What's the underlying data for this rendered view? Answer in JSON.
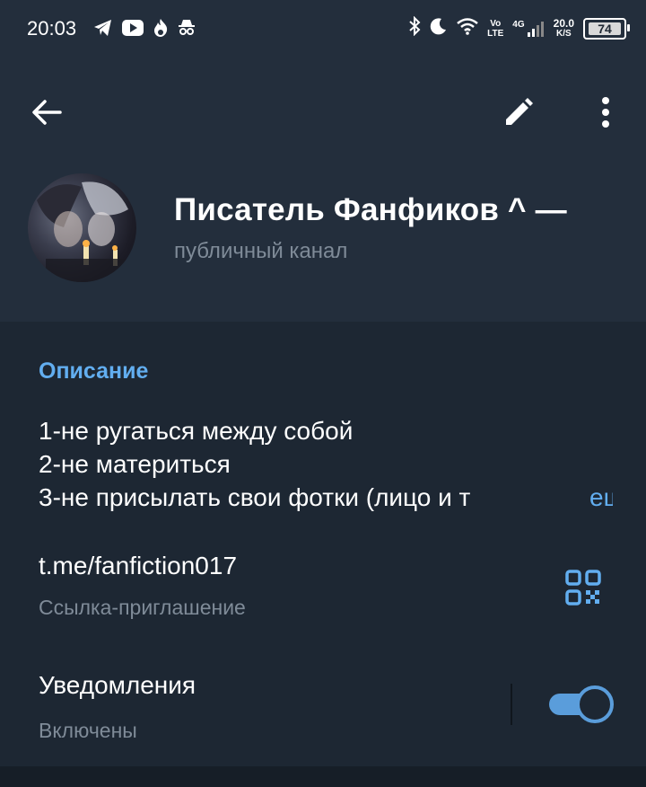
{
  "status_bar": {
    "time": "20:03",
    "left_icons": [
      "telegram-icon",
      "youtube-icon",
      "fire-icon",
      "incognito-icon"
    ],
    "right_icons": [
      "bluetooth-icon",
      "moon-icon",
      "wifi-icon",
      "volte-icon",
      "signal-4g-icon"
    ],
    "volte_top": "Vo",
    "volte_bottom": "LTE",
    "network": "4G",
    "speed_value": "20.0",
    "speed_unit": "K/S",
    "battery": "74"
  },
  "toolbar": {
    "back_icon": "arrow-left-icon",
    "edit_icon": "pencil-icon",
    "more_icon": "more-vertical-icon"
  },
  "profile": {
    "title": "Писатель Фанфиков ^ —",
    "subtitle": "публичный канал"
  },
  "description": {
    "label": "Описание",
    "line1": "1-не ругаться между собой",
    "line2": "2-не материться",
    "line3": "3-не присылать свои фотки (лицо и т",
    "more": "ещё"
  },
  "invite_link": {
    "url": "t.me/fanfiction017",
    "caption": "Ссылка-приглашение",
    "qr_icon": "qr-code-icon"
  },
  "notifications": {
    "title": "Уведомления",
    "caption": "Включены",
    "enabled": true
  },
  "colors": {
    "background": "#1d2733",
    "header": "#232e3c",
    "accent": "#62aef0",
    "secondary_text": "#7f8b98",
    "toggle": "#5a9ddb"
  }
}
